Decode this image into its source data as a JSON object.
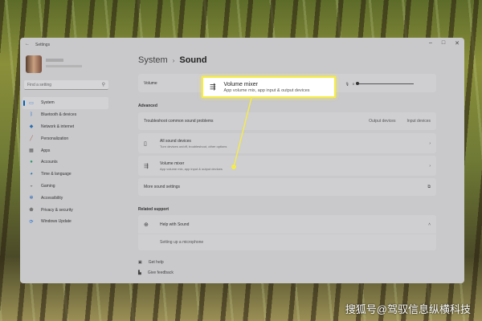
{
  "window": {
    "title": "Settings",
    "controls": [
      "–",
      "□",
      "✕"
    ]
  },
  "search": {
    "placeholder": "Find a setting"
  },
  "sidebar": {
    "items": [
      {
        "label": "System",
        "icon": "monitor-icon",
        "glyph": "▭",
        "color": "#2b7bd0"
      },
      {
        "label": "Bluetooth & devices",
        "icon": "bluetooth-icon",
        "glyph": "ᛒ",
        "color": "#1a6fd1"
      },
      {
        "label": "Network & internet",
        "icon": "wifi-icon",
        "glyph": "◆",
        "color": "#2a6fb0"
      },
      {
        "label": "Personalization",
        "icon": "brush-icon",
        "glyph": "╱",
        "color": "#a07050"
      },
      {
        "label": "Apps",
        "icon": "apps-icon",
        "glyph": "▦",
        "color": "#555"
      },
      {
        "label": "Accounts",
        "icon": "person-icon",
        "glyph": "●",
        "color": "#2e9a6a"
      },
      {
        "label": "Time & language",
        "icon": "globe-clock-icon",
        "glyph": "◕",
        "color": "#2a7fb0"
      },
      {
        "label": "Gaming",
        "icon": "gamepad-icon",
        "glyph": "◒",
        "color": "#777"
      },
      {
        "label": "Accessibility",
        "icon": "accessibility-icon",
        "glyph": "✲",
        "color": "#1a5fb0"
      },
      {
        "label": "Privacy & security",
        "icon": "shield-icon",
        "glyph": "⬟",
        "color": "#777"
      },
      {
        "label": "Windows Update",
        "icon": "update-icon",
        "glyph": "⟳",
        "color": "#1a6fd1"
      }
    ]
  },
  "breadcrumb": {
    "parent": "System",
    "separator": "›",
    "current": "Sound"
  },
  "volume": {
    "label": "Volume",
    "value": "0",
    "value_percent": 0
  },
  "advanced": {
    "heading": "Advanced",
    "troubleshoot": {
      "label": "Troubleshoot common sound problems",
      "output": "Output devices",
      "input": "Input devices"
    },
    "all_devices": {
      "title": "All sound devices",
      "subtitle": "Turn devices on/off, troubleshoot, other options"
    },
    "volume_mixer": {
      "title": "Volume mixer",
      "subtitle": "App volume mix, app input & output devices"
    },
    "more": {
      "label": "More sound settings"
    }
  },
  "related": {
    "heading": "Related support",
    "help": "Help with Sound",
    "link": "Setting up a microphone"
  },
  "footer": {
    "get_help": "Get help",
    "feedback": "Give feedback"
  },
  "callout": {
    "title": "Volume mixer",
    "subtitle": "App volume mix, app input & output devices",
    "color": "#f5ec4a"
  },
  "watermark": "搜狐号@驾驭信息纵横科技"
}
